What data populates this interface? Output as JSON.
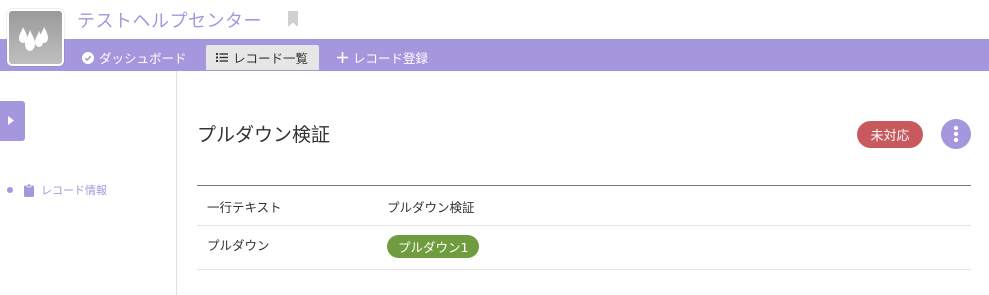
{
  "app": {
    "title": "テストヘルプセンター"
  },
  "nav": {
    "tabs": [
      {
        "label": "ダッシュボード",
        "icon": "check-circle-icon",
        "active": false
      },
      {
        "label": "レコード一覧",
        "icon": "list-icon",
        "active": true
      },
      {
        "label": "レコード登録",
        "icon": "plus-icon",
        "active": false
      }
    ]
  },
  "sidebar": {
    "items": [
      {
        "label": "レコード情報",
        "icon": "clipboard-icon"
      }
    ]
  },
  "record": {
    "title": "プルダウン検証",
    "status": "未対応",
    "fields": [
      {
        "name": "一行テキスト",
        "value": "プルダウン検証"
      },
      {
        "name": "プルダウン",
        "value": "プルダウン1"
      }
    ]
  },
  "colors": {
    "accent": "#a597dd",
    "status_badge": "#c85a5f",
    "dropdown_pill": "#6e9c3e"
  }
}
